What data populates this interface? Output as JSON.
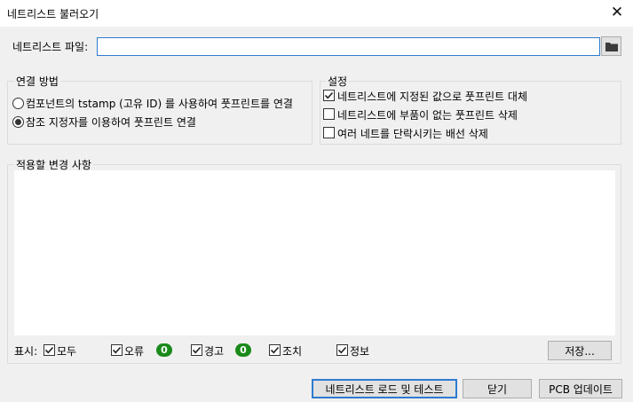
{
  "window": {
    "title": "네트리스트 불러오기"
  },
  "file": {
    "label": "네트리스트 파일:",
    "value": "",
    "placeholder": ""
  },
  "connection": {
    "title": "연결 방법",
    "options": [
      {
        "label": "컴포넌트의 tstamp (고유 ID) 를 사용하여 풋프린트를 연결",
        "selected": false
      },
      {
        "label": "참조 지정자를 이용하여 풋프린트 연결",
        "selected": true
      }
    ]
  },
  "settings": {
    "title": "설정",
    "options": [
      {
        "label": "네트리스트에 지정된 값으로 풋프린트 대체",
        "checked": true
      },
      {
        "label": "네트리스트에 부품이 없는 풋프린트 삭제",
        "checked": false
      },
      {
        "label": "여러 네트를 단락시키는 배선 삭제",
        "checked": false
      }
    ]
  },
  "changes": {
    "title": "적용할 변경 사항",
    "items": []
  },
  "filter": {
    "label": "표시:",
    "items": [
      {
        "label": "모두",
        "checked": true
      },
      {
        "label": "오류",
        "checked": true,
        "count": "0"
      },
      {
        "label": "경고",
        "checked": true,
        "count": "0"
      },
      {
        "label": "조치",
        "checked": true
      },
      {
        "label": "정보",
        "checked": true
      }
    ]
  },
  "buttons": {
    "save": "저장...",
    "load_test": "네트리스트 로드 및 테스트",
    "close": "닫기",
    "update_pcb": "PCB 업데이트"
  },
  "colors": {
    "accent": "#2f7bd0",
    "badge": "#1a8a1a"
  }
}
